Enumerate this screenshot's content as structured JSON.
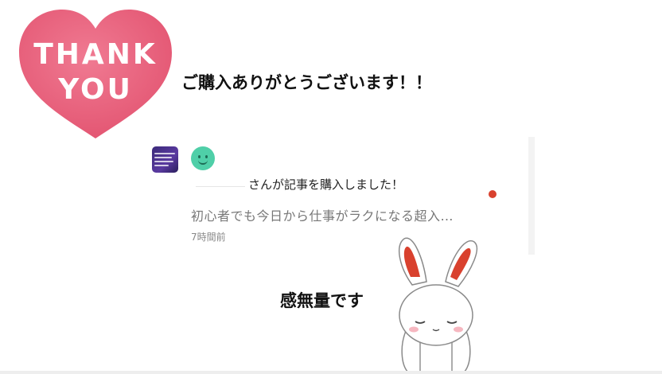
{
  "sticker": {
    "line1": "THANK",
    "line2": "YOU"
  },
  "thanks_message": "ご購入ありがとうございます！！",
  "notification": {
    "title": "さんが記事を購入しました！",
    "body": "初心者でも今日から仕事がラクになる超入…",
    "time": "7時間前",
    "unread": true
  },
  "closing_message": "感無量です",
  "colors": {
    "heart": "#e8627d",
    "unread_dot": "#d9412e",
    "avatar": "#4fcfa8",
    "thumbnail": "#3b2a7a"
  },
  "icons": {
    "heart": "heart-sticker-icon",
    "bunny": "bunny-illustration-icon",
    "avatar": "smiley-avatar-icon",
    "unread": "unread-dot-icon"
  }
}
